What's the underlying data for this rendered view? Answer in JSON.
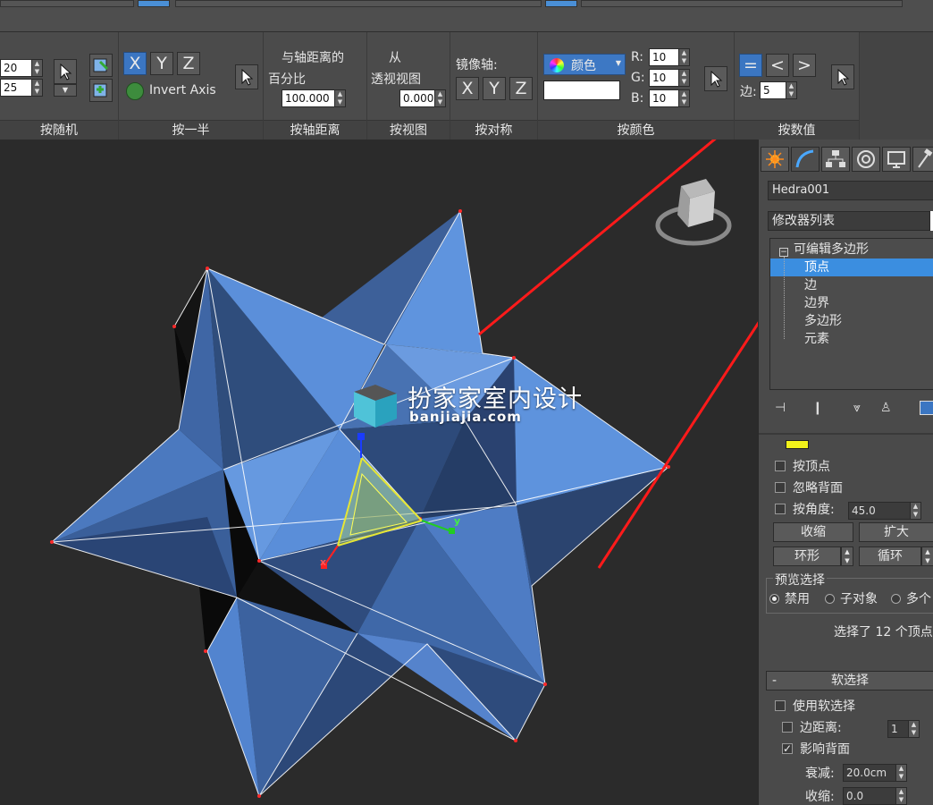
{
  "ribbon": {
    "random": {
      "spin1": "20",
      "spin2": "25",
      "label": "按随机"
    },
    "half": {
      "x": "X",
      "y": "Y",
      "z": "Z",
      "invert_axis": "Invert Axis",
      "label": "按一半"
    },
    "axis_distance": {
      "line1": "与轴距离的",
      "line2": "百分比",
      "value": "100.000",
      "label": "按轴距离"
    },
    "view": {
      "line1": "从",
      "line2": "透视视图",
      "value": "0.000",
      "label": "按视图"
    },
    "symmetry": {
      "title": "镜像轴:",
      "x": "X",
      "y": "Y",
      "z": "Z",
      "label": "按对称"
    },
    "color": {
      "dropdown": "颜色",
      "r_label": "R:",
      "r": "10",
      "g_label": "G:",
      "g": "10",
      "b_label": "B:",
      "b": "10",
      "label": "按颜色"
    },
    "numeric": {
      "eq": "=",
      "lt": "<",
      "gt": ">",
      "edges_label": "边:",
      "edges": "5",
      "label": "按数值"
    }
  },
  "viewport": {
    "watermark_title": "扮家家室内设计",
    "watermark_url": "banjiajia.com",
    "gizmo_x": "x",
    "gizmo_y": "y"
  },
  "panel": {
    "object_name": "Hedra001",
    "modifier_list": "修改器列表",
    "stack": [
      "可编辑多边形",
      "顶点",
      "边",
      "边界",
      "多边形",
      "元素"
    ],
    "by_vertex": "按顶点",
    "ignore_backfacing": "忽略背面",
    "by_angle": "按角度:",
    "angle_value": "45.0",
    "shrink": "收缩",
    "grow": "扩大",
    "ring": "环形",
    "loop": "循环",
    "preview_selection": "预览选择",
    "preview_options": [
      "禁用",
      "子对象",
      "多个"
    ],
    "selection_status": "选择了 12 个顶点",
    "soft_selection": "软选择",
    "soft_selection_toggle": "-",
    "use_soft_selection": "使用软选择",
    "edge_distance": "边距离:",
    "edge_distance_value": "1",
    "affect_backfacing": "影响背面",
    "falloff": "衰减:",
    "falloff_value": "20.0cm",
    "pinch": "收缩:",
    "pinch_value": "0.0"
  },
  "colors": {
    "accent_blue": "#3b8ee0",
    "annotation_red": "#ff1a1a",
    "mesh_light": "#5a8fdc",
    "mesh_dark": "#263a5e"
  }
}
